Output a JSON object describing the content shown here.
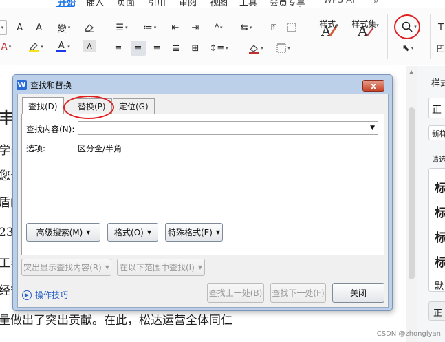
{
  "ribbon": {
    "tabs": [
      "开始",
      "插入",
      "页面",
      "引用",
      "审阅",
      "视图",
      "工具",
      "会员专享",
      "WPS AI"
    ],
    "active_tab": "开始",
    "style_button_label": "样式",
    "style_set_label": "样式集"
  },
  "document": {
    "lines": [
      "丰",
      "学:",
      "您长",
      "盾的",
      "23",
      "工参",
      "经守",
      "量做出了突出贡献。在此，松达运营全体同仁",
      "…"
    ]
  },
  "style_pane": {
    "title": "样式",
    "current": "正",
    "new_button": "新样",
    "prompt": "请选",
    "items": [
      "标",
      "标",
      "标",
      "标",
      "默"
    ],
    "bottom": "正"
  },
  "dialog": {
    "title": "查找和替换",
    "close": "x",
    "tabs": [
      "查找(D)",
      "替换(P)",
      "定位(G)"
    ],
    "find_label": "查找内容(N):",
    "find_value": "",
    "options_label": "选项:",
    "options_value": "区分全/半角",
    "advanced_search": "高级搜索(M)",
    "format": "格式(O)",
    "special_format": "特殊格式(E)",
    "highlight": "突出显示查找内容(R)",
    "find_in": "在以下范围中查找(I)",
    "tips": "操作技巧",
    "find_prev": "查找上一处(B)",
    "find_next": "查找下一处(F)",
    "close_button": "关闭"
  },
  "watermark": "CSDN @zhonglyan",
  "colors": {
    "accent": "#1a73e8",
    "circle": "#e02020",
    "dialog_frame": "#bcd1e9"
  }
}
